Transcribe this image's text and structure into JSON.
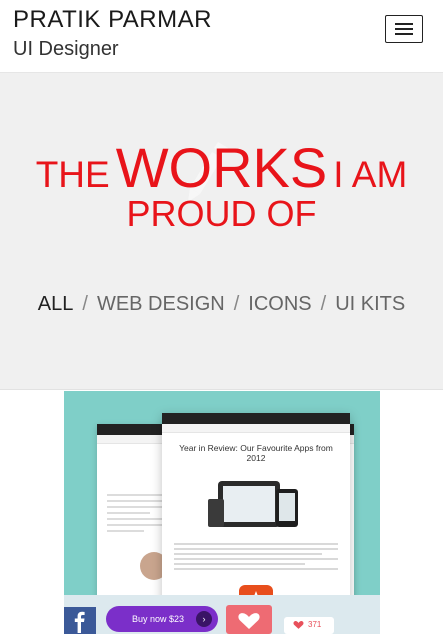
{
  "header": {
    "name": "PRATIK PARMAR",
    "role": "UI Designer",
    "menu_icon": "hamburger-menu-icon"
  },
  "hero": {
    "title_prefix": "THE",
    "title_emphasis": "WORKS",
    "title_suffix": "I AM",
    "title_line2": "PROUD OF",
    "accent_color": "#e8141a",
    "background_color": "#f0f0f0"
  },
  "filters": {
    "items": [
      "ALL",
      "WEB DESIGN",
      "ICONS",
      "UI KITS"
    ],
    "separator": "/",
    "active": "ALL"
  },
  "work": {
    "background_color": "#7fcfc8",
    "mock_title": "Year in Review: Our Favourite Apps from 2012",
    "buy_label": "Buy now $23",
    "like_count": "371"
  }
}
